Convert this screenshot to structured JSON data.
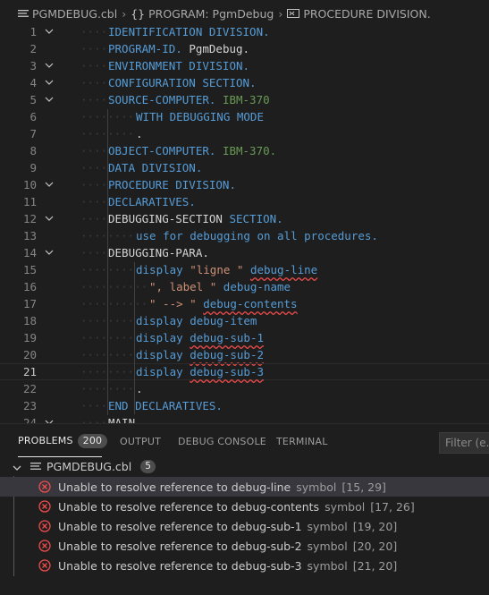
{
  "breadcrumb": {
    "file": "PGMDEBUG.cbl",
    "program": "PROGRAM: PgmDebug",
    "procedure": "PROCEDURE DIVISION."
  },
  "editor": {
    "current_line": 21,
    "lines": [
      {
        "n": "1",
        "fold": true,
        "indent": 1,
        "tokens": [
          [
            "kw",
            "IDENTIFICATION DIVISION."
          ]
        ]
      },
      {
        "n": "2",
        "fold": false,
        "indent": 1,
        "tokens": [
          [
            "kw",
            "PROGRAM-ID. "
          ],
          [
            "id",
            "PgmDebug."
          ]
        ]
      },
      {
        "n": "3",
        "fold": true,
        "indent": 1,
        "tokens": [
          [
            "kw",
            "ENVIRONMENT DIVISION."
          ]
        ]
      },
      {
        "n": "4",
        "fold": true,
        "indent": 1,
        "tokens": [
          [
            "kw",
            "CONFIGURATION SECTION."
          ]
        ]
      },
      {
        "n": "5",
        "fold": true,
        "indent": 1,
        "tokens": [
          [
            "kw",
            "SOURCE-COMPUTER. "
          ],
          [
            "grn",
            "IBM-370"
          ]
        ]
      },
      {
        "n": "6",
        "fold": false,
        "indent": 2,
        "tokens": [
          [
            "kw",
            "WITH DEBUGGING MODE"
          ]
        ]
      },
      {
        "n": "7",
        "fold": false,
        "indent": 2,
        "tokens": [
          [
            "id",
            "."
          ]
        ]
      },
      {
        "n": "8",
        "fold": false,
        "indent": 1,
        "tokens": [
          [
            "kw",
            "OBJECT-COMPUTER. "
          ],
          [
            "grn",
            "IBM-370."
          ]
        ]
      },
      {
        "n": "9",
        "fold": false,
        "indent": 1,
        "tokens": [
          [
            "kw",
            "DATA DIVISION."
          ]
        ]
      },
      {
        "n": "10",
        "fold": true,
        "indent": 1,
        "tokens": [
          [
            "kw",
            "PROCEDURE DIVISION."
          ]
        ]
      },
      {
        "n": "11",
        "fold": false,
        "indent": 1,
        "tokens": [
          [
            "kw",
            "DECLARATIVES."
          ]
        ]
      },
      {
        "n": "12",
        "fold": true,
        "indent": 1,
        "tokens": [
          [
            "id",
            "DEBUGGING-SECTION "
          ],
          [
            "kw",
            "SECTION."
          ]
        ]
      },
      {
        "n": "13",
        "fold": false,
        "indent": 2,
        "tokens": [
          [
            "kw",
            "use for debugging on all procedures."
          ]
        ]
      },
      {
        "n": "14",
        "fold": true,
        "indent": 1,
        "tokens": [
          [
            "id",
            "DEBUGGING-PARA."
          ]
        ]
      },
      {
        "n": "15",
        "fold": false,
        "indent": 2,
        "tokens": [
          [
            "kw",
            "display "
          ],
          [
            "str",
            "\"ligne \" "
          ],
          [
            "dbg",
            "debug-line"
          ]
        ]
      },
      {
        "n": "16",
        "fold": false,
        "indent": 3,
        "tokens": [
          [
            "str",
            "\", label \" "
          ],
          [
            "kw",
            "debug-name"
          ]
        ]
      },
      {
        "n": "17",
        "fold": false,
        "indent": 3,
        "tokens": [
          [
            "str",
            "\" --> \" "
          ],
          [
            "dbg",
            "debug-contents"
          ]
        ]
      },
      {
        "n": "18",
        "fold": false,
        "indent": 2,
        "tokens": [
          [
            "kw",
            "display debug-item"
          ]
        ]
      },
      {
        "n": "19",
        "fold": false,
        "indent": 2,
        "tokens": [
          [
            "kw",
            "display "
          ],
          [
            "dbg",
            "debug-sub-1"
          ]
        ]
      },
      {
        "n": "20",
        "fold": false,
        "indent": 2,
        "tokens": [
          [
            "kw",
            "display "
          ],
          [
            "dbg",
            "debug-sub-2"
          ]
        ]
      },
      {
        "n": "21",
        "fold": false,
        "indent": 2,
        "tokens": [
          [
            "kw",
            "display "
          ],
          [
            "dbg",
            "debug-sub-3"
          ]
        ]
      },
      {
        "n": "22",
        "fold": false,
        "indent": 2,
        "tokens": [
          [
            "id",
            "."
          ]
        ]
      },
      {
        "n": "23",
        "fold": false,
        "indent": 1,
        "tokens": [
          [
            "kw",
            "END DECLARATIVES."
          ]
        ]
      },
      {
        "n": "24",
        "fold": true,
        "indent": 1,
        "tokens": [
          [
            "id",
            "MAIN."
          ]
        ]
      }
    ]
  },
  "panel": {
    "tabs": [
      {
        "label": "PROBLEMS",
        "badge": "200",
        "active": true
      },
      {
        "label": "OUTPUT"
      },
      {
        "label": "DEBUG CONSOLE"
      },
      {
        "label": "TERMINAL"
      }
    ],
    "filter_placeholder": "Filter (e.g.",
    "file": {
      "name": "PGMDEBUG.cbl",
      "count": "5"
    },
    "problems": [
      {
        "message": "Unable to resolve reference to debug-line",
        "source": "symbol",
        "position": "[15, 29]",
        "selected": true
      },
      {
        "message": "Unable to resolve reference to debug-contents",
        "source": "symbol",
        "position": "[17, 26]"
      },
      {
        "message": "Unable to resolve reference to debug-sub-1",
        "source": "symbol",
        "position": "[19, 20]"
      },
      {
        "message": "Unable to resolve reference to debug-sub-2",
        "source": "symbol",
        "position": "[20, 20]"
      },
      {
        "message": "Unable to resolve reference to debug-sub-3",
        "source": "symbol",
        "position": "[21, 20]"
      }
    ]
  },
  "icons": {
    "file": "lines-file-icon",
    "braces": "braces-icon",
    "procedure": "symbol-namespace-icon",
    "error": "error-circle-icon",
    "error_color": "#f14c4c"
  }
}
